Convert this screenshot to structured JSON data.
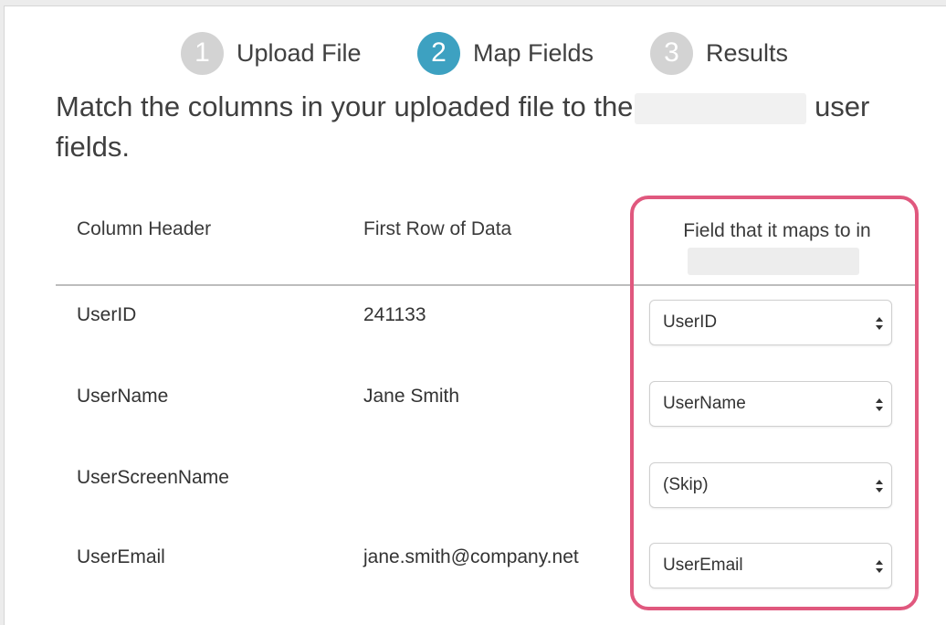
{
  "steps": [
    {
      "number": "1",
      "label": "Upload File",
      "state": "inactive"
    },
    {
      "number": "2",
      "label": "Map Fields",
      "state": "active"
    },
    {
      "number": "3",
      "label": "Results",
      "state": "inactive"
    }
  ],
  "instruction": {
    "before": "Match the columns in your uploaded file to the",
    "after": "user fields."
  },
  "table": {
    "headers": {
      "column_header": "Column Header",
      "first_row": "First Row of Data",
      "maps_to": "Field that it maps to in"
    },
    "rows": [
      {
        "column": "UserID",
        "data": "241133",
        "mapping": "UserID"
      },
      {
        "column": "UserName",
        "data": "Jane Smith",
        "mapping": "UserName"
      },
      {
        "column": "UserScreenName",
        "data": "",
        "mapping": "(Skip)"
      },
      {
        "column": "UserEmail",
        "data": "jane.smith@company.net",
        "mapping": "UserEmail"
      }
    ]
  },
  "colors": {
    "active_step": "#3da1c1",
    "inactive_step": "#d3d3d3",
    "highlight": "#e0587e"
  }
}
